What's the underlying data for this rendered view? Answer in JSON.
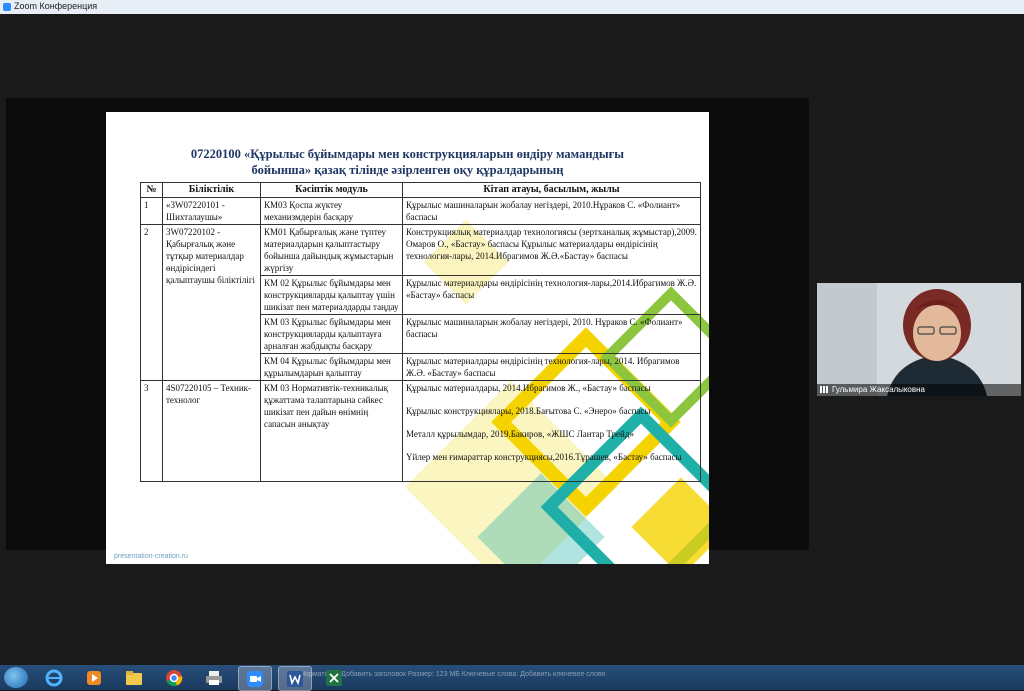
{
  "window": {
    "title": "Zoom Конференция"
  },
  "slide": {
    "title_line1": "07220100 «Құрылыс бұйымдары мен конструкцияларын өндіру         мамандығы",
    "title_line2": "бойынша» қазақ тілінде әзірленген оқу құралдарының",
    "watermark": "presentation-creation.ru",
    "table": {
      "headers": [
        "№",
        "Біліктілік",
        "Кәсіптік модуль",
        "Кітап атауы, басылым, жылы"
      ],
      "r1": {
        "num": "1",
        "qual": "«3W07220101 - Шихталаушы»",
        "module": "КМ03  Қоспа жүктеу механизмдерін басқару",
        "book": "Құрылыс машиналарын жобалау негіздері, 2010.Нұраков С. «Фолиант» баспасы"
      },
      "r2": {
        "num": "2",
        "qual": "3W07220102 - Қабырғалық және тұтқыр материалдар өндірісіндегі қалыптаушы біліктілігі",
        "m1": "КМ01   Қабырғалық және түптеу материалдарын қалыптастыру бойынша дайындық жұмыстарын жүргізу",
        "b1": "Конструкциялық материалдар технологиясы (зертханалық жұмыстар),2009. Омаров О., «Бастау» баспасы Құрылыс материалдары өндірісінің технология-лары, 2014.Ибрагимов Ж.Ә.«Бастау» баспасы",
        "m2": "КМ 02 Құрылыс бұйымдары мен конструкцияларды қалыптау үшін шикізат пен материалдарды таңдау",
        "b2": "Құрылыс материалдары өндірісінің технология-лары,2014.Ибрагимов Ж.Ә. «Бастау» баспасы",
        "m3": "КМ 03 Құрылыс бұйымдары мен конструкцияларды қалыптауға арналған жабдықты басқару",
        "b3": "Құрылыс машиналарын жобалау негіздері, 2010. Нұраков С. «Фолиант» баспасы",
        "m4": "КМ 04 Құрылыс бұйымдары мен құрылымдарын қалыптау",
        "b4": "Құрылыс материалдары өндірісінің технология-лары, 2014. Ибрагимов Ж.Ә. «Бастау» баспасы"
      },
      "r3": {
        "num": "3",
        "qual": "4S07220105 – Техник-технолог",
        "module": "КМ 03 Нормативтік-техникалық құжаттама талаптарына сәйкес шикізат пен дайын өнімнің сапасын анықтау",
        "b1": "Құрылыс материалдары, 2014.Ибрагимов Ж., «Бастау» баспасы",
        "b2": "Құрылыс конструкциялары, 2018.Бағытова С. «Энеро» баспасы",
        "b3": "Металл құрылымдар, 2019.Бакиров, «ЖШС Лантар Трейд»",
        "b4": "Үйлер мен ғимараттар конструкциясы,2016.Тұрашев, «Бастау» баспасы"
      }
    }
  },
  "participant": {
    "name": "Гульмира Жаксалыкoвна"
  },
  "taskbar": {
    "ghost_text": "Нормативы: Добавить заголовок    Размер: 123 МБ    Ключевые слова: Добавить ключевое слово"
  },
  "colors": {
    "accent_yellow": "#f5d300",
    "accent_teal": "#1fb0a8",
    "accent_green": "#8cc63f"
  }
}
